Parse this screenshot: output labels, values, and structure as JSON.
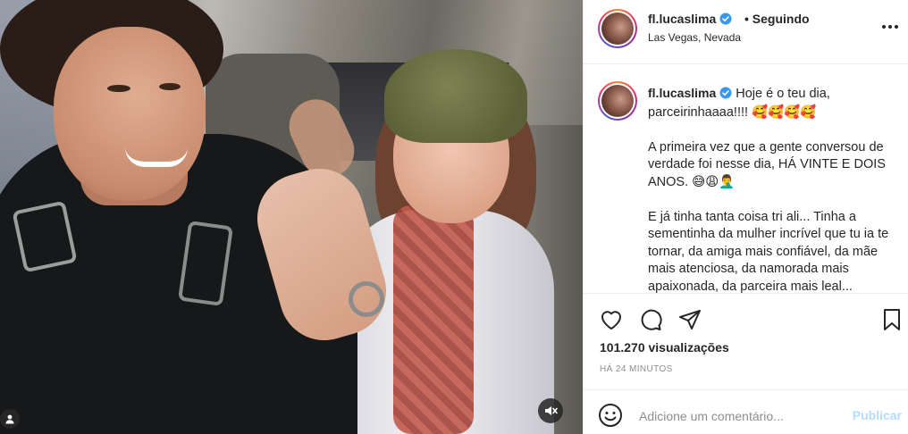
{
  "post": {
    "username": "fl.lucaslima",
    "follow_status": "• Seguindo",
    "location": "Las Vegas, Nevada",
    "caption": "Hoje é o teu dia, parceirinhaaaa!!!! 🥰🥰🥰🥰\n\nA primeira vez que a gente conversou de verdade foi nesse dia, HÁ VINTE E DOIS ANOS. 😅😩🤦‍♂️\n\nE já tinha tanta coisa tri ali... Tinha a sementinha da mulher incrível que tu ia te tornar, da amiga mais confiável, da mãe mais atenciosa, da namorada mais apaixonada, da parceira mais leal...",
    "views": "101.270 visualizações",
    "time_ago": "HÁ 24 MINUTOS"
  },
  "comment": {
    "placeholder": "Adicione um comentário...",
    "publish_label": "Publicar"
  },
  "icons": {
    "verified": "verified-badge-icon",
    "like": "heart-icon",
    "comment": "comment-bubble-icon",
    "share": "paper-plane-icon",
    "save": "bookmark-icon",
    "emoji": "smiley-icon",
    "more": "more-options-icon",
    "mute": "muted-speaker-icon",
    "tagged_users": "user-icon"
  },
  "colors": {
    "verified_blue": "#3897f0",
    "publish_disabled": "#b3dbff",
    "muted_text": "#8e8e8e"
  }
}
